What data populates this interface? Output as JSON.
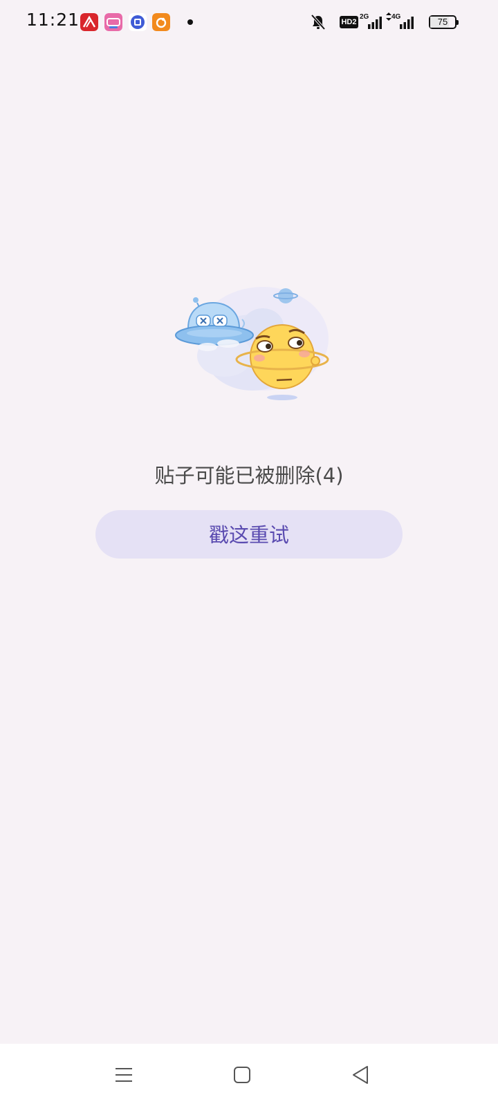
{
  "status_bar": {
    "time": "11:21",
    "notification_apps": [
      "xuexi-app-icon",
      "bilibili-app-icon",
      "tieba-app-icon",
      "orange-app-icon"
    ],
    "hd_label": "HD2",
    "network_1": "2G",
    "network_2": "4G",
    "battery_level": "75",
    "battery_percent": 75
  },
  "main": {
    "error_message": "贴子可能已被删除(4)",
    "retry_label": "戳这重试"
  },
  "colors": {
    "background": "#f7f2f6",
    "retry_bg": "#e5e1f5",
    "retry_text": "#5a4bb0"
  },
  "nav_bar": {
    "icons": [
      "menu-icon",
      "home-icon",
      "back-icon"
    ]
  }
}
